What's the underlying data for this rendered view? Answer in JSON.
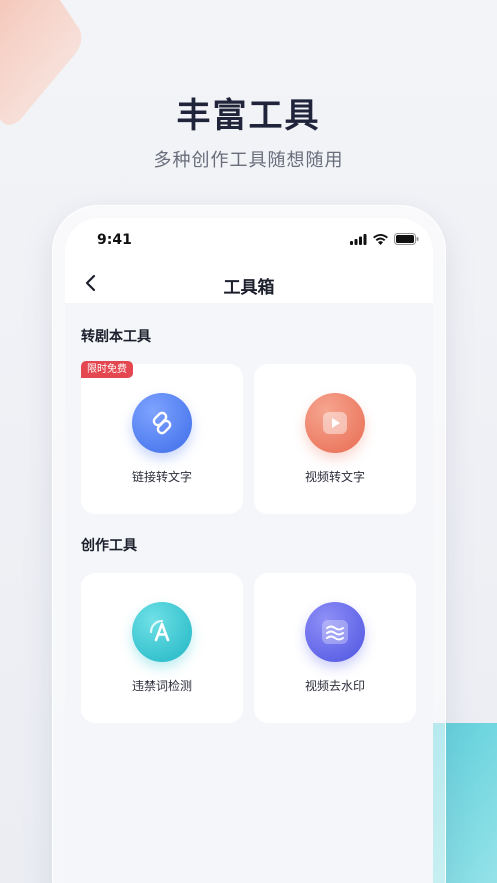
{
  "promo": {
    "headline": "丰富工具",
    "subheadline": "多种创作工具随想随用"
  },
  "status_bar": {
    "time": "9:41"
  },
  "nav": {
    "title": "工具箱"
  },
  "sections": [
    {
      "title": "转剧本工具",
      "cards": [
        {
          "label": "链接转文字",
          "icon": "link-icon",
          "badge": "限时免费",
          "color": "#4a7cf0"
        },
        {
          "label": "视频转文字",
          "icon": "play-icon",
          "color": "#ee7a64"
        }
      ]
    },
    {
      "title": "创作工具",
      "cards": [
        {
          "label": "违禁词检测",
          "icon": "letter-a-icon",
          "color": "#29c2cf"
        },
        {
          "label": "视频去水印",
          "icon": "wave-icon",
          "color": "#5d64ea"
        }
      ]
    }
  ]
}
